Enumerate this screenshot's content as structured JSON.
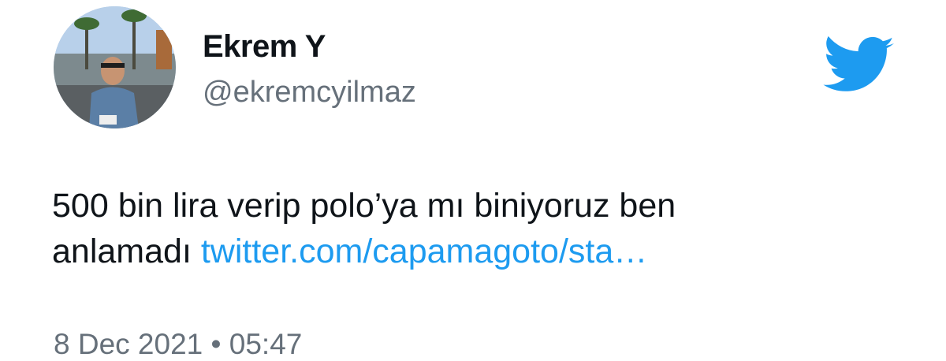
{
  "colors": {
    "text": "#0f1419",
    "secondary_text": "#66707a",
    "link": "#1d9bf0",
    "twitter_blue": "#1d9bf0",
    "background": "#ffffff"
  },
  "author": {
    "display_name": "Ekrem Y",
    "handle": "@ekremcyilmaz",
    "avatar_icon": "profile-photo"
  },
  "brand": {
    "icon": "twitter-bird-icon"
  },
  "tweet": {
    "text_line_1": "500 bin lira verip polo’ya mı biniyoruz ben",
    "text_line_2_prefix": "anlamadı ",
    "link_text": "twitter.com/capamagoto/sta…"
  },
  "timestamp": {
    "text": "8 Dec 2021 • 05:47"
  }
}
